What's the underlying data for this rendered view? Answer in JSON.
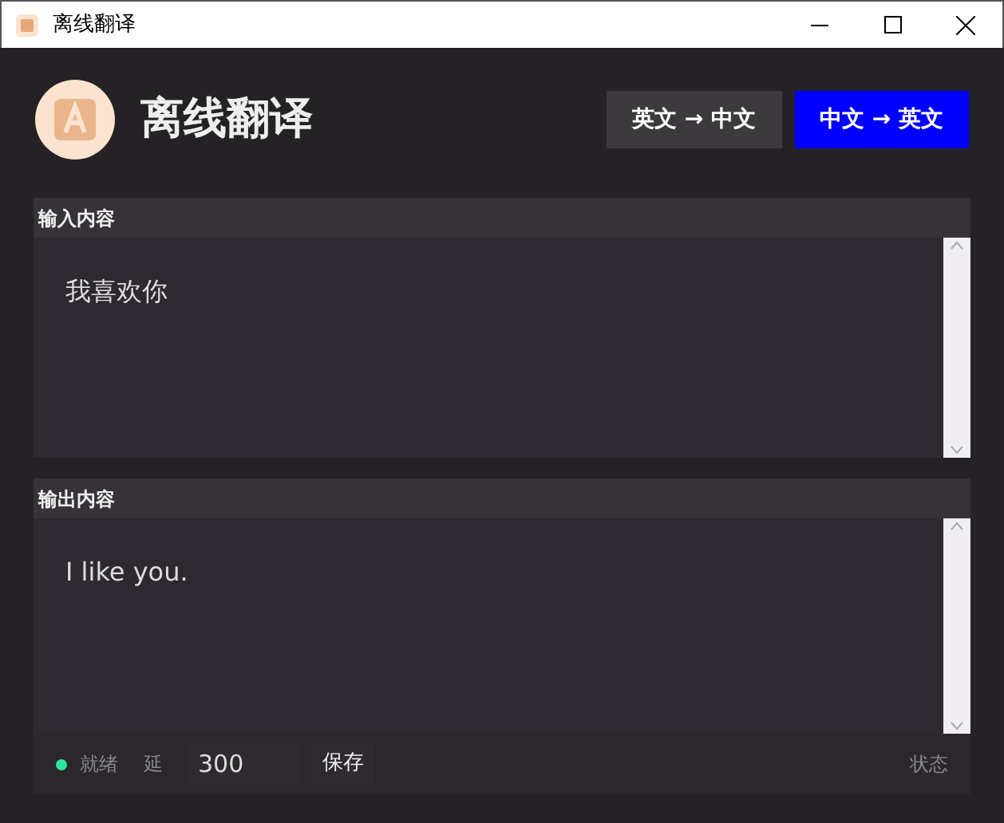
{
  "window": {
    "title": "离线翻译"
  },
  "header": {
    "title": "离线翻译"
  },
  "directions": [
    {
      "label": "英文 → 中文",
      "selected": false
    },
    {
      "label": "中文 → 英文",
      "selected": true
    }
  ],
  "input": {
    "label": "输入内容",
    "value": "我喜欢你"
  },
  "output": {
    "label": "输出内容",
    "value": "I like you."
  },
  "status_bar": {
    "status": "就绪",
    "color": "#2ee59d",
    "delay_label": "延",
    "delay_value": "300",
    "save": "保存",
    "right_text": "状态"
  }
}
